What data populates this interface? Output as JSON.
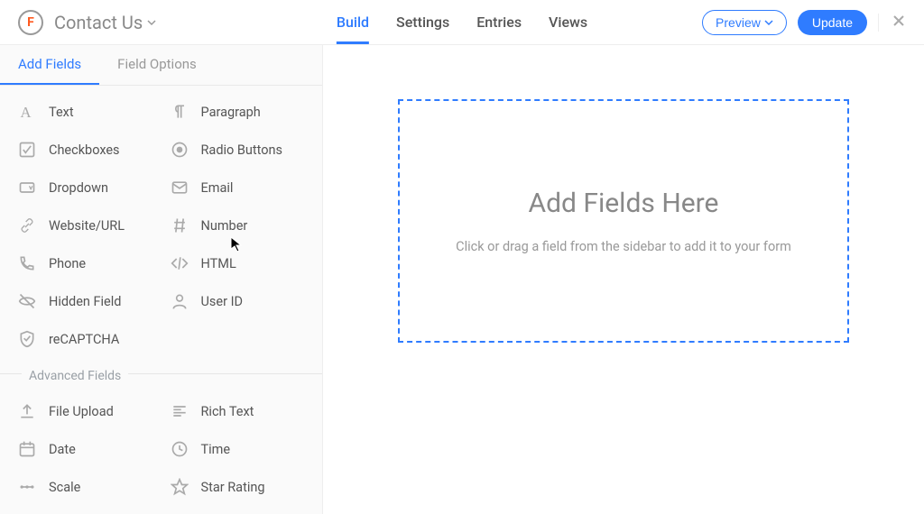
{
  "header": {
    "form_title": "Contact Us",
    "nav": {
      "build": "Build",
      "settings": "Settings",
      "entries": "Entries",
      "views": "Views"
    },
    "preview": "Preview",
    "update": "Update"
  },
  "sidebar": {
    "tabs": {
      "add_fields": "Add Fields",
      "field_options": "Field Options"
    },
    "basic_fields": {
      "text": "Text",
      "paragraph": "Paragraph",
      "checkboxes": "Checkboxes",
      "radio": "Radio Buttons",
      "dropdown": "Dropdown",
      "email": "Email",
      "website": "Website/URL",
      "number": "Number",
      "phone": "Phone",
      "html": "HTML",
      "hidden": "Hidden Field",
      "user_id": "User ID",
      "recaptcha": "reCAPTCHA"
    },
    "advanced_label": "Advanced Fields",
    "advanced_fields": {
      "file_upload": "File Upload",
      "rich_text": "Rich Text",
      "date": "Date",
      "time": "Time",
      "scale": "Scale",
      "star": "Star Rating"
    }
  },
  "canvas": {
    "title": "Add Fields Here",
    "subtitle": "Click or drag a field from the sidebar to add it to your form"
  }
}
